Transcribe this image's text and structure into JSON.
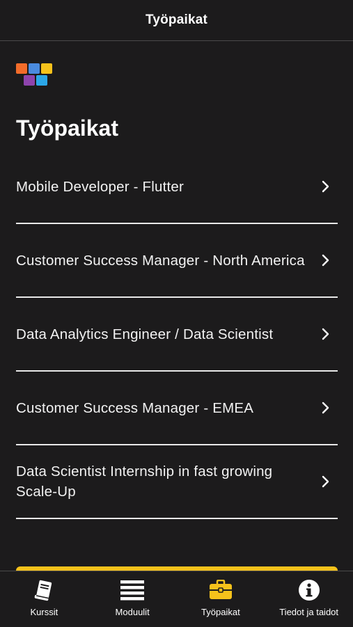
{
  "header": {
    "title": "Työpaikat"
  },
  "logo": {
    "icon": "app-logo-icon",
    "tile_colors": [
      "#f26c2a",
      "#4a8bdf",
      "#f6c21b",
      "#8e44ad",
      "#2ba7e8"
    ]
  },
  "main": {
    "heading": "Työpaikat",
    "jobs": [
      {
        "title": "Mobile Developer - Flutter"
      },
      {
        "title": "Customer Success Manager - North America"
      },
      {
        "title": "Data Analytics Engineer / Data Scientist"
      },
      {
        "title": "Customer Success Manager - EMEA"
      },
      {
        "title": "Data Scientist Internship in fast growing Scale-Up"
      }
    ],
    "accent_color": "#f6c21b"
  },
  "tabbar": {
    "active_tab": "Työpaikat",
    "tabs": [
      {
        "label": "Kurssit",
        "icon": "book-icon"
      },
      {
        "label": "Moduulit",
        "icon": "list-icon"
      },
      {
        "label": "Työpaikat",
        "icon": "briefcase-icon"
      },
      {
        "label": "Tiedot ja taidot",
        "icon": "info-icon"
      }
    ]
  }
}
